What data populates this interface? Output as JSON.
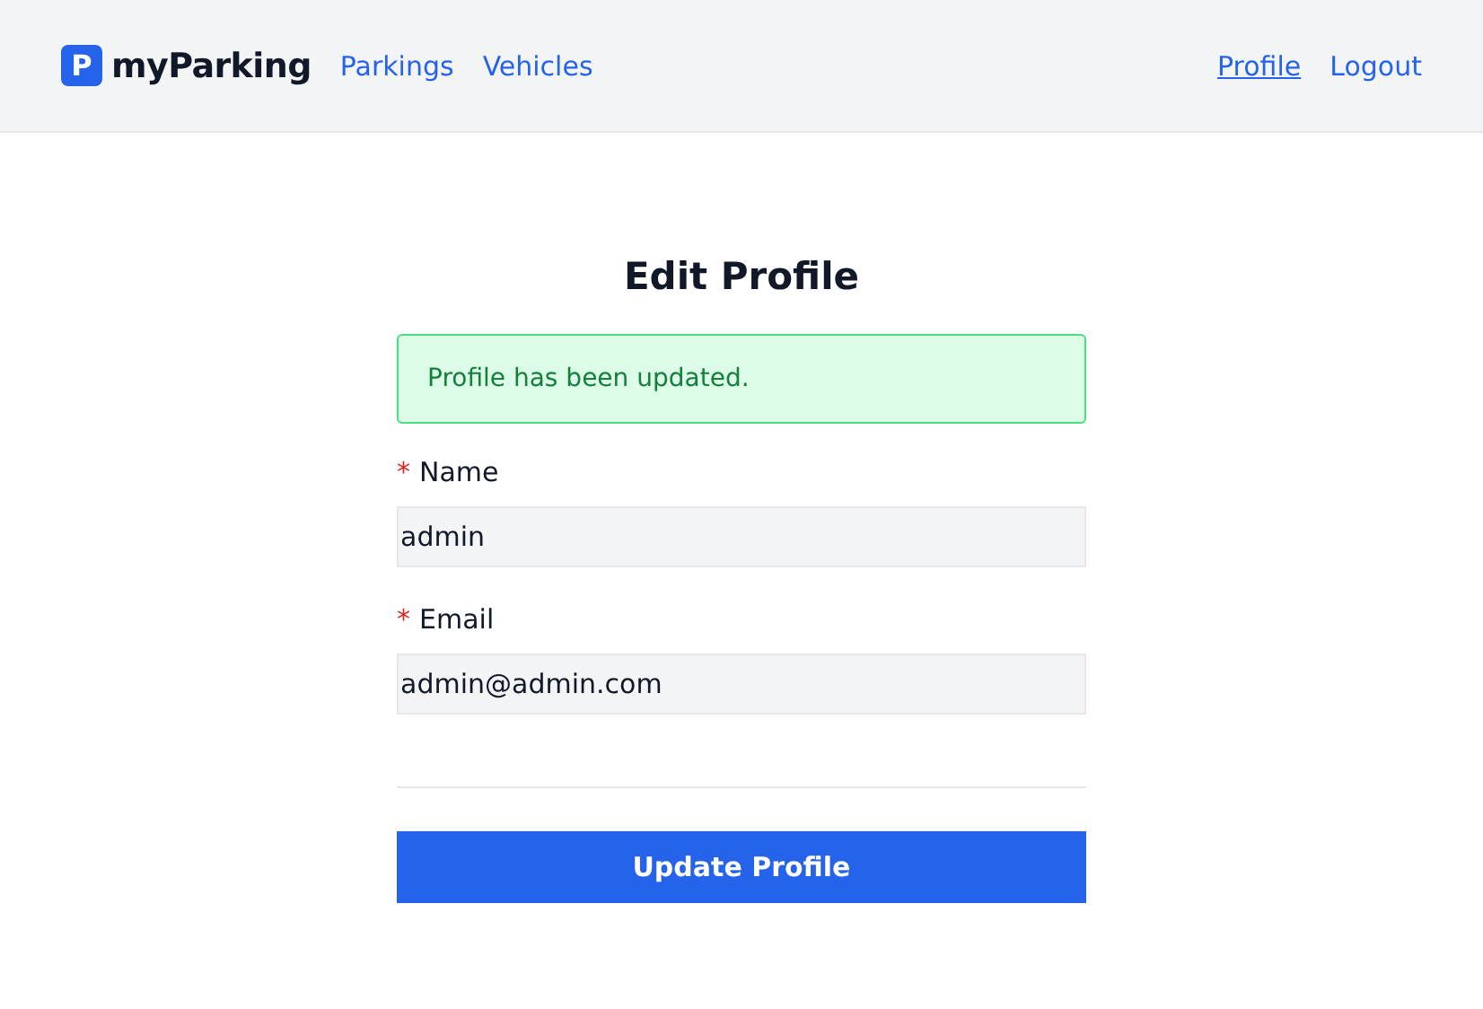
{
  "header": {
    "logo_mark": "P",
    "brand": "myParking",
    "nav_left": [
      {
        "label": "Parkings",
        "selected": false
      },
      {
        "label": "Vehicles",
        "selected": false
      }
    ],
    "nav_right": [
      {
        "label": "Profile",
        "selected": true
      },
      {
        "label": "Logout",
        "selected": false
      }
    ]
  },
  "title": "Edit Profile",
  "alert": {
    "text": "Profile has been updated."
  },
  "fields": [
    {
      "required_mark": "*",
      "label": "Name",
      "value": "admin",
      "required": true
    },
    {
      "required_mark": "*",
      "label": "Email",
      "value": "admin@admin.com",
      "required": true
    }
  ],
  "submit_button": "Update Profile"
}
